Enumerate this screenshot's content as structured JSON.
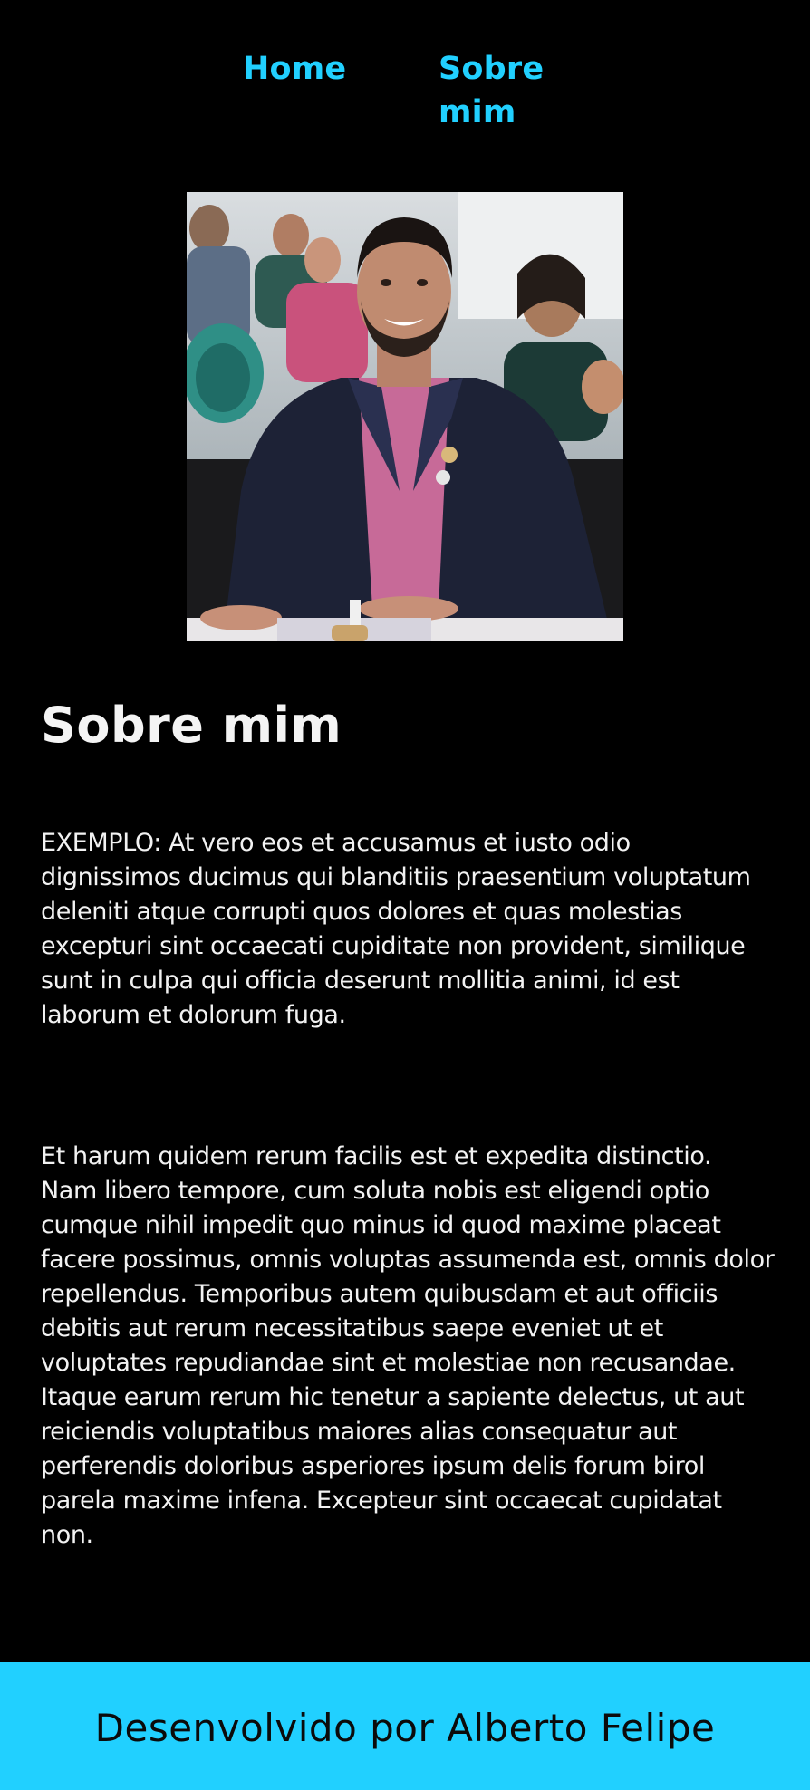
{
  "nav": {
    "home_label": "Home",
    "about_label": "Sobre mim"
  },
  "profile": {
    "photo_alt": "Foto de Alberto Felipe"
  },
  "main": {
    "title": "Sobre mim",
    "paragraphs": [
      "EXEMPLO: At vero eos et accusamus et iusto odio dignissimos ducimus qui blanditiis praesentium voluptatum deleniti atque corrupti quos dolores et quas molestias excepturi sint occaecati cupiditate non provident, similique sunt in culpa qui officia deserunt mollitia animi, id est laborum et dolorum fuga.",
      "Et harum quidem rerum facilis est et expedita distinctio. Nam libero tempore, cum soluta nobis est eligendi optio cumque nihil impedit quo minus id quod maxime placeat facere possimus, omnis voluptas assumenda est, omnis dolor repellendus. Temporibus autem quibusdam et aut officiis debitis aut rerum necessitatibus saepe eveniet ut et voluptates repudiandae sint et molestiae non recusandae. Itaque earum rerum hic tenetur a sapiente delectus, ut aut reiciendis voluptatibus maiores alias consequatur aut perferendis doloribus asperiores ipsum delis forum birol parela maxime infena. Excepteur sint occaecat cupidatat non."
    ]
  },
  "footer": {
    "text": "Desenvolvido por Alberto Felipe"
  },
  "colors": {
    "background": "#000000",
    "accent": "#21d0ff",
    "text": "#f2f2f2",
    "footer_text": "#0b0b0b"
  }
}
